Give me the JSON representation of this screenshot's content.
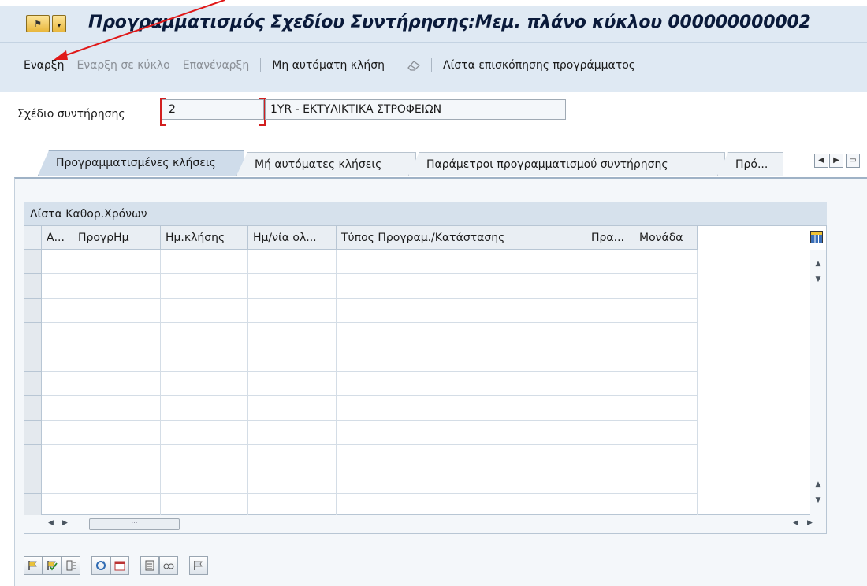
{
  "window": {
    "title": "Προγραμματισμός Σχεδίου Συντήρησης:Μεμ. πλάνο κύκλου 000000000002"
  },
  "toolbar": {
    "start": "Εναρξη",
    "start_in_cycle": "Εναρξη σε κύκλο",
    "restart": "Επανέναρξη",
    "manual_call": "Μη αυτόματη κλήση",
    "overview_list": "Λίστα επισκόπησης προγράμματος"
  },
  "plan_field": {
    "label": "Σχέδιο συντήρησης",
    "value": "2",
    "description": "1YR - ΕΚΤΥΛΙΚΤΙΚΑ ΣΤΡΟΦΕΙΩΝ"
  },
  "tabs": [
    {
      "label": "Προγραμματισμένες κλήσεις",
      "active": true
    },
    {
      "label": "Μή αυτόματες κλήσεις",
      "active": false
    },
    {
      "label": "Παράμετροι προγραμματισμού συντήρησης",
      "active": false
    },
    {
      "label": "Πρό...",
      "active": false
    }
  ],
  "table": {
    "title": "Λίστα Καθορ.Χρόνων",
    "columns": [
      "Α...",
      "ΠρογρΗμ",
      "Ημ.κλήσης",
      "Ημ/νία ολ...",
      "Τύπος Προγραμ./Κατάστασης",
      "Πρα...",
      "Μονάδα"
    ],
    "rows": []
  },
  "colors": {
    "accent": "#d21f1f",
    "toolbar_bg": "#dfe9f3",
    "tab_active": "#cfdcea"
  }
}
